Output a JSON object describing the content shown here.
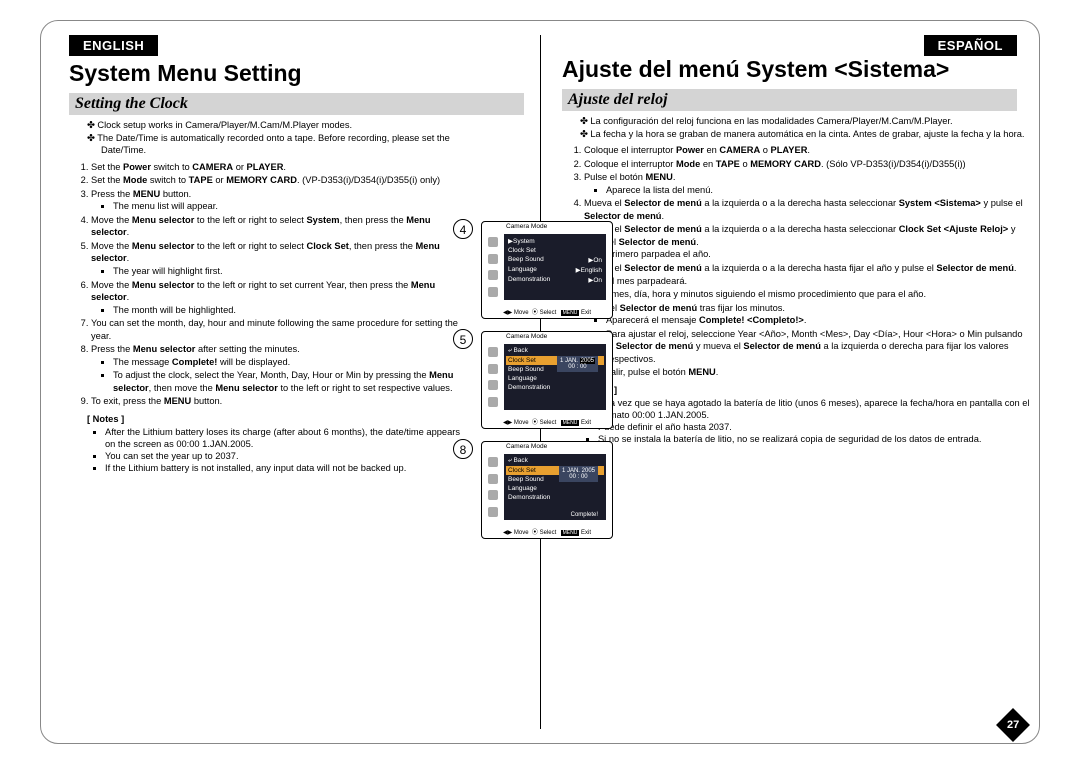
{
  "page_number": "27",
  "left": {
    "lang": "ENGLISH",
    "h1": "System Menu Setting",
    "h2": "Setting the Clock",
    "intro": [
      "Clock setup works in Camera/Player/M.Cam/M.Player modes.",
      "The Date/Time is automatically recorded onto a tape.\nBefore recording, please set the Date/Time."
    ],
    "steps": [
      "Set the <b>Power</b> switch to <b>CAMERA</b> or <b>PLAYER</b>.",
      "Set the <b>Mode</b> switch to <b>TAPE</b> or <b>MEMORY CARD</b>.\n(VP-D353(i)/D354(i)/D355(i) only)",
      "Press the <b>MENU</b> button.",
      "Move the <b>Menu selector</b> to the left or right to select <b>System</b>, then press the <b>Menu selector</b>.",
      "Move the <b>Menu selector</b> to the left or right to select <b>Clock Set</b>, then press the <b>Menu selector</b>.",
      "Move the <b>Menu selector</b> to the left or right to set current Year, then press the <b>Menu selector</b>.",
      "You can set the month, day, hour and minute following the same procedure for setting the year.",
      "Press the <b>Menu selector</b> after setting the minutes.",
      "To exit, press the <b>MENU</b> button."
    ],
    "subnotes": {
      "3": [
        "The menu list will appear."
      ],
      "5": [
        "The year will highlight first."
      ],
      "6": [
        "The month will be highlighted."
      ],
      "8": [
        "The message <b>Complete!</b> will be displayed.",
        "To adjust the clock, select the Year, Month, Day, Hour or Min by pressing the <b>Menu selector</b>, then move the <b>Menu selector</b> to the left or right to set respective values."
      ]
    },
    "notes_h": "[ Notes ]",
    "notes": [
      "After the Lithium battery loses its charge (after about 6 months), the date/time appears on the screen as 00:00 1.JAN.2005.",
      "You can set the year up to 2037.",
      "If the Lithium battery is not installed, any input data will not be backed up."
    ]
  },
  "right": {
    "lang": "ESPAÑOL",
    "h1": "Ajuste del menú System <Sistema>",
    "h2": "Ajuste del reloj",
    "intro": [
      "La configuración del reloj funciona en las modalidades Camera/Player/M.Cam/M.Player.",
      "La fecha y la hora se graban de manera automática en la cinta.\nAntes de grabar, ajuste la fecha y la hora."
    ],
    "steps": [
      "Coloque el interruptor <b>Power</b> en <b>CAMERA</b> o <b>PLAYER</b>.",
      "Coloque el interruptor <b>Mode</b> en <b>TAPE</b> o <b>MEMORY CARD</b>. (Sólo VP-D353(i)/D354(i)/D355(i))",
      "Pulse el botón <b>MENU</b>.",
      "Mueva el <b>Selector de menú</b> a la izquierda o a la derecha hasta seleccionar <b>System &lt;Sistema&gt;</b> y pulse el <b>Selector de menú</b>.",
      "Mueva el <b>Selector de menú</b> a la izquierda o a la derecha hasta seleccionar <b>Clock Set &lt;Ajuste Reloj&gt;</b> y pulse el <b>Selector de menú</b>.",
      "Mueva el <b>Selector de menú</b> a la izquierda o a la derecha hasta fijar el año y pulse el <b>Selector de menú</b>.",
      "Fije el mes, día, hora y minutos siguiendo el mismo procedimiento que para el año.",
      "Pulse el <b>Selector de menú</b> tras fijar los minutos.",
      "Para salir, pulse el botón <b>MENU</b>."
    ],
    "subnotes": {
      "3": [
        "Aparece la lista del menú."
      ],
      "5": [
        "Primero parpadea el año."
      ],
      "6": [
        "El mes parpadeará."
      ],
      "8": [
        "Aparecerá el mensaje <b>Complete! &lt;Completo!&gt;</b>.",
        "Para ajustar el reloj, seleccione Year &lt;Año&gt;, Month &lt;Mes&gt;, Day &lt;Día&gt;, Hour &lt;Hora&gt; o Min pulsando el <b>Selector de menú</b> y mueva el <b>Selector de menú</b> a la izquierda o derecha para fijar los valores respectivos."
      ]
    },
    "notes_h": "[ Notas ]",
    "notes": [
      "Una vez que se haya agotado la batería de litio (unos 6 meses), aparece la fecha/hora en pantalla con el formato 00:00 1.JAN.2005.",
      "Puede definir el año hasta 2037.",
      "Si no se instala la batería de litio, no se realizará copia de seguridad de los datos de entrada."
    ]
  },
  "screens": {
    "labels": {
      "4": "4",
      "5": "5",
      "8": "8"
    },
    "mode_title": "Camera Mode",
    "bottom": {
      "move": "Move",
      "select": "Select",
      "exit": "Exit",
      "menu": "MENU"
    },
    "s4": {
      "items": [
        {
          "label": "▶System",
          "val": ""
        },
        {
          "label": "Clock Set",
          "val": ""
        },
        {
          "label": "Beep Sound",
          "val": "▶On"
        },
        {
          "label": "Language",
          "val": "▶English"
        },
        {
          "label": "Demonstration",
          "val": "▶On"
        }
      ]
    },
    "s5": {
      "back": "⤶ Back",
      "items": [
        {
          "label": "Clock Set",
          "sel": true
        },
        {
          "label": "Beep Sound"
        },
        {
          "label": "Language"
        },
        {
          "label": "Demonstration"
        }
      ],
      "date_day": "1",
      "date_mon": "JAN.",
      "date_year": "2005",
      "time": "00 : 00"
    },
    "s8": {
      "back": "⤶ Back",
      "items": [
        {
          "label": "Clock Set",
          "sel": true
        },
        {
          "label": "Beep Sound"
        },
        {
          "label": "Language"
        },
        {
          "label": "Demonstration"
        }
      ],
      "date_day": "1",
      "date_mon": "JAN.",
      "date_year": "2005",
      "time": "00 : 00",
      "complete": "Complete!"
    }
  }
}
